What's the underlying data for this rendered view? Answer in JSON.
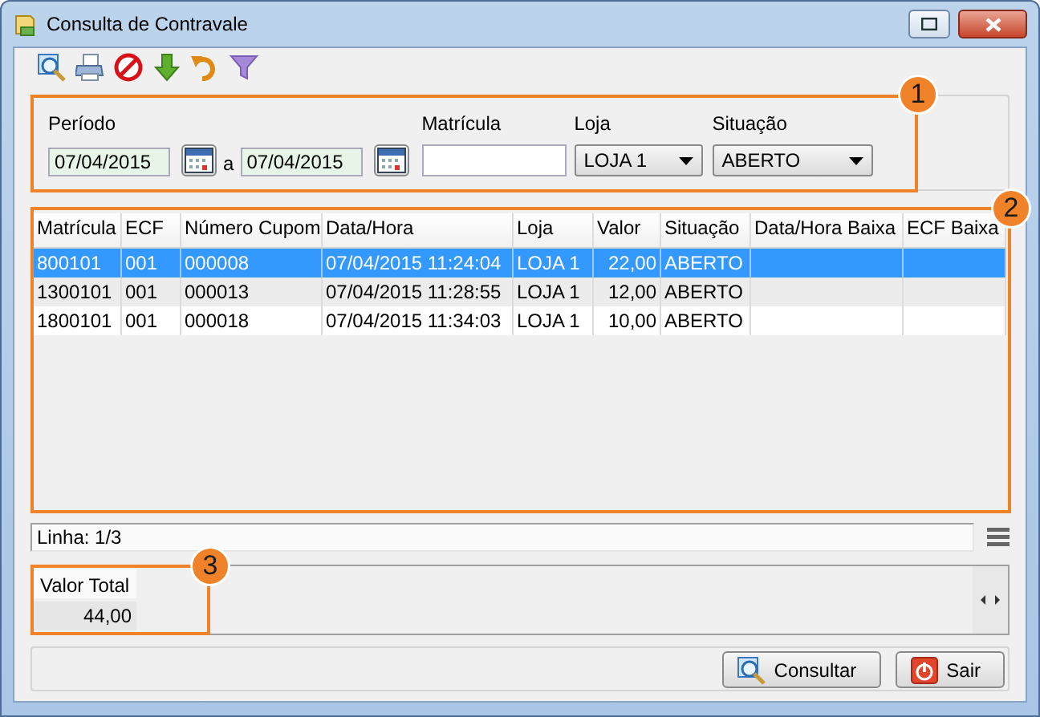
{
  "window": {
    "title": "Consulta de Contravale"
  },
  "filters": {
    "callout": "1",
    "period_label": "Período",
    "date_from": "07/04/2015",
    "separator": "a",
    "date_to": "07/04/2015",
    "matricula_label": "Matrícula",
    "loja_label": "Loja",
    "loja_value": "LOJA 1",
    "situacao_label": "Situação",
    "situacao_value": "ABERTO"
  },
  "table": {
    "callout": "2",
    "columns": [
      "Matrícula",
      "ECF",
      "Número Cupom",
      "Data/Hora",
      "Loja",
      "Valor",
      "Situação",
      "Data/Hora Baixa",
      "ECF Baixa"
    ],
    "rows": [
      {
        "selected": true,
        "cells": [
          "800101",
          "001",
          "000008",
          "07/04/2015 11:24:04",
          "LOJA 1",
          "22,00",
          "ABERTO",
          "",
          ""
        ]
      },
      {
        "selected": false,
        "cells": [
          "1300101",
          "001",
          "000013",
          "07/04/2015 11:28:55",
          "LOJA 1",
          "12,00",
          "ABERTO",
          "",
          ""
        ]
      },
      {
        "selected": false,
        "cells": [
          "1800101",
          "001",
          "000018",
          "07/04/2015 11:34:03",
          "LOJA 1",
          "10,00",
          "ABERTO",
          "",
          ""
        ]
      }
    ]
  },
  "status_bar": "Linha: 1/3",
  "totals": {
    "callout": "3",
    "label": "Valor Total",
    "value": "44,00"
  },
  "buttons": [
    {
      "kind": "search",
      "label": "Consultar"
    },
    {
      "kind": "exit",
      "label": "Sair"
    }
  ]
}
